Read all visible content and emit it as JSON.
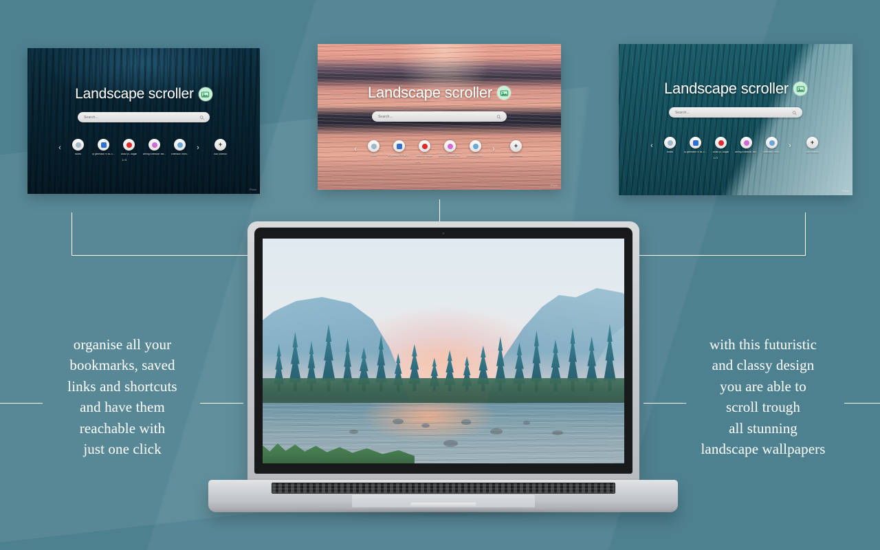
{
  "theme": {
    "background": "#4e8190",
    "accent_green": "#c7f2d8",
    "line_color": "#ffffff"
  },
  "product": {
    "title": "Landscape scroller",
    "brand_icon": "landscape-image-icon"
  },
  "search": {
    "placeholder": "Search...",
    "icon": "search-icon"
  },
  "shortcuts": {
    "prev_arrow": "‹",
    "next_arrow": "›",
    "add_label": "Add Shortcut",
    "add_glyph": "+",
    "page_indicator": "1/3",
    "items": [
      {
        "label": "tickets",
        "color": "#9fb8cc",
        "icon": "bookmark-icon"
      },
      {
        "label": "pp generator HTML colour pi...",
        "color": "#2f6fd0",
        "icon": "code-icon"
      },
      {
        "label": "colour pi...bagan",
        "color": "#e02b2b",
        "icon": "palette-icon"
      },
      {
        "label": "Writing Extension Team...",
        "color": "#d26ad8",
        "icon": "pen-icon"
      },
      {
        "label": "Extension Team...",
        "color": "#6aa7d8",
        "icon": "puzzle-icon"
      }
    ]
  },
  "cards": [
    {
      "id": "card-night-forest",
      "wallpaper": "dark blue night forest",
      "credit": "Photo"
    },
    {
      "id": "card-ocean-sunset",
      "wallpaper": "pink sunset ocean waves",
      "credit": "Photo"
    },
    {
      "id": "card-teal-hillside",
      "wallpaper": "teal pine hillside",
      "credit": "Photo"
    }
  ],
  "laptop": {
    "wallpaper": "Yosemite valley river at dawn"
  },
  "captions": {
    "left": [
      "organise all your",
      "bookmarks, saved",
      "links and shortcuts",
      "and have them",
      "reachable with",
      "just one click"
    ],
    "right": [
      "with this futuristic",
      "and classy design",
      "you are able  to",
      "scroll trough",
      "all stunning",
      "landscape wallpapers"
    ]
  }
}
